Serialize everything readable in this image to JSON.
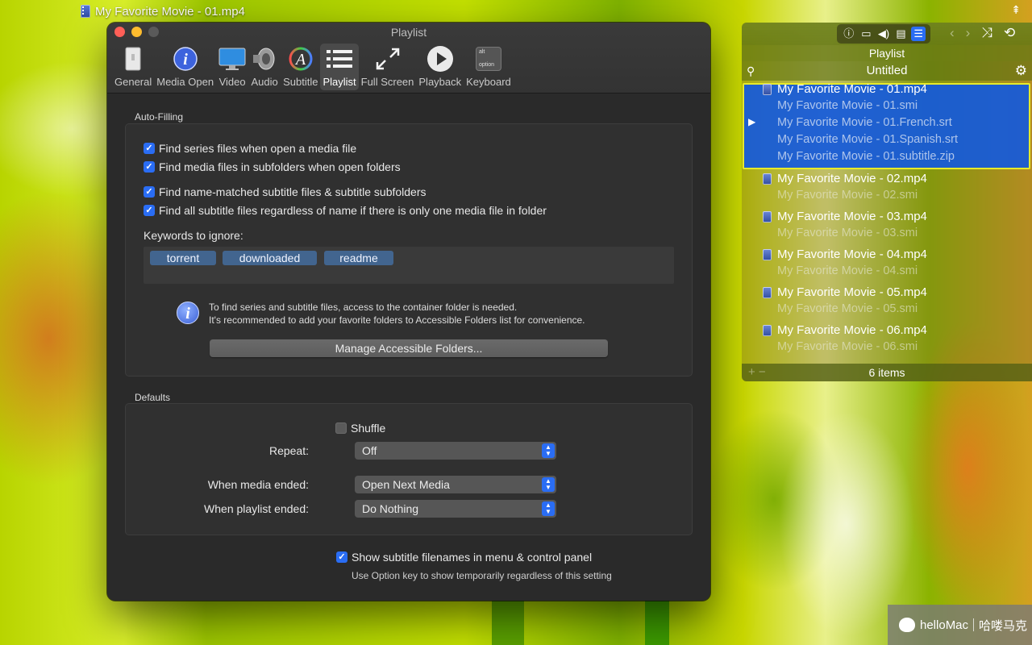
{
  "video": {
    "title": "My Favorite Movie - 01.mp4"
  },
  "prefs": {
    "window_title": "Playlist",
    "toolbar": [
      {
        "label": "General",
        "icon": "general-icon"
      },
      {
        "label": "Media Open",
        "icon": "info-icon"
      },
      {
        "label": "Video",
        "icon": "monitor-icon"
      },
      {
        "label": "Audio",
        "icon": "speaker-icon"
      },
      {
        "label": "Subtitle",
        "icon": "subtitle-font-icon"
      },
      {
        "label": "Playlist",
        "icon": "list-icon",
        "active": true
      },
      {
        "label": "Full Screen",
        "icon": "fullscreen-icon"
      },
      {
        "label": "Playback",
        "icon": "play-icon"
      },
      {
        "label": "Keyboard",
        "icon": "option-key-icon"
      }
    ],
    "option_key": {
      "top": "alt",
      "bottom": "option"
    },
    "auto_filling": {
      "label": "Auto-Filling",
      "checks": [
        {
          "label": "Find series files when open a media file",
          "checked": true
        },
        {
          "label": "Find media files in subfolders when open folders",
          "checked": true
        },
        {
          "label": "Find name-matched subtitle files & subtitle subfolders",
          "checked": true
        },
        {
          "label": "Find all subtitle files regardless of name if there is only one media file in folder",
          "checked": true
        }
      ],
      "keywords_label": "Keywords to ignore:",
      "keywords": [
        "torrent",
        "downloaded",
        "readme"
      ],
      "info_line1": "To find series and subtitle files, access to the container folder is needed.",
      "info_line2": "It's recommended to add your favorite folders to Accessible Folders list for convenience.",
      "manage_button": "Manage Accessible Folders..."
    },
    "defaults": {
      "label": "Defaults",
      "shuffle_label": "Shuffle",
      "shuffle_checked": false,
      "repeat_label": "Repeat:",
      "repeat_value": "Off",
      "media_ended_label": "When media ended:",
      "media_ended_value": "Open Next Media",
      "playlist_ended_label": "When playlist ended:",
      "playlist_ended_value": "Do Nothing"
    },
    "show_subtitle": {
      "label": "Show subtitle filenames in menu & control panel",
      "checked": true,
      "hint": "Use Option key to show temporarily regardless of this setting"
    }
  },
  "playlist": {
    "title": "Playlist",
    "name": "Untitled",
    "items": [
      {
        "name": "My Favorite Movie - 01.mp4",
        "subs": [
          "My Favorite Movie - 01.smi",
          "My Favorite Movie - 01.French.srt",
          "My Favorite Movie - 01.Spanish.srt",
          "My Favorite Movie - 01.subtitle.zip"
        ],
        "selected": true,
        "playing": true
      },
      {
        "name": "My Favorite Movie - 02.mp4",
        "subs": [
          "My Favorite Movie - 02.smi"
        ]
      },
      {
        "name": "My Favorite Movie - 03.mp4",
        "subs": [
          "My Favorite Movie - 03.smi"
        ]
      },
      {
        "name": "My Favorite Movie - 04.mp4",
        "subs": [
          "My Favorite Movie - 04.smi"
        ]
      },
      {
        "name": "My Favorite Movie - 05.mp4",
        "subs": [
          "My Favorite Movie - 05.smi"
        ]
      },
      {
        "name": "My Favorite Movie - 06.mp4",
        "subs": [
          "My Favorite Movie - 06.smi"
        ]
      }
    ],
    "count": "6 items",
    "toolbar_icons": [
      "info-icon",
      "screen-icon",
      "volume-icon",
      "subtitle-icon",
      "playlist-icon"
    ]
  },
  "watermark": {
    "brand": "helloMac",
    "cn": "哈喽马克"
  },
  "colors": {
    "accent": "#2a6df4",
    "selection": "#1a5ee0",
    "highlight_border": "#e6ea2a"
  }
}
